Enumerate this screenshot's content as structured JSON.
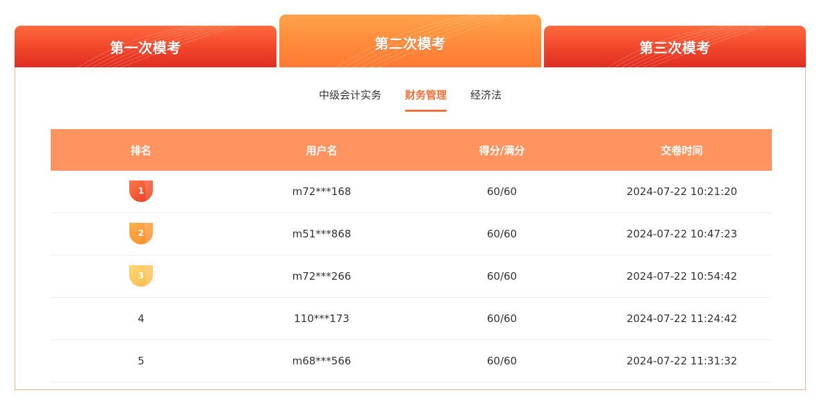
{
  "exam_tabs": [
    {
      "label": "第一次模考",
      "active": false
    },
    {
      "label": "第二次模考",
      "active": true
    },
    {
      "label": "第三次模考",
      "active": false
    }
  ],
  "subject_tabs": [
    {
      "label": "中级会计实务",
      "active": false
    },
    {
      "label": "财务管理",
      "active": true
    },
    {
      "label": "经济法",
      "active": false
    }
  ],
  "table": {
    "headers": [
      "排名",
      "用户名",
      "得分/满分",
      "交卷时间"
    ],
    "rows": [
      {
        "rank": "1",
        "user": "m72***168",
        "score": "60/60",
        "time": "2024-07-22 10:21:20",
        "medal": "medal-gold-icon"
      },
      {
        "rank": "2",
        "user": "m51***868",
        "score": "60/60",
        "time": "2024-07-22 10:47:23",
        "medal": "medal-orange-icon"
      },
      {
        "rank": "3",
        "user": "m72***266",
        "score": "60/60",
        "time": "2024-07-22 10:54:42",
        "medal": "medal-yellow-icon"
      },
      {
        "rank": "4",
        "user": "110***173",
        "score": "60/60",
        "time": "2024-07-22 11:24:42",
        "medal": null
      },
      {
        "rank": "5",
        "user": "m68***566",
        "score": "60/60",
        "time": "2024-07-22 11:31:32",
        "medal": null
      }
    ]
  },
  "colors": {
    "accent": "#f2703a",
    "header_bg": "#ff9461",
    "inactive_tab": "#ef4029",
    "active_tab": "#ff8a3a",
    "medal_1": "#f2532f",
    "medal_2": "#ff9a3c",
    "medal_3": "#ffc65a"
  }
}
